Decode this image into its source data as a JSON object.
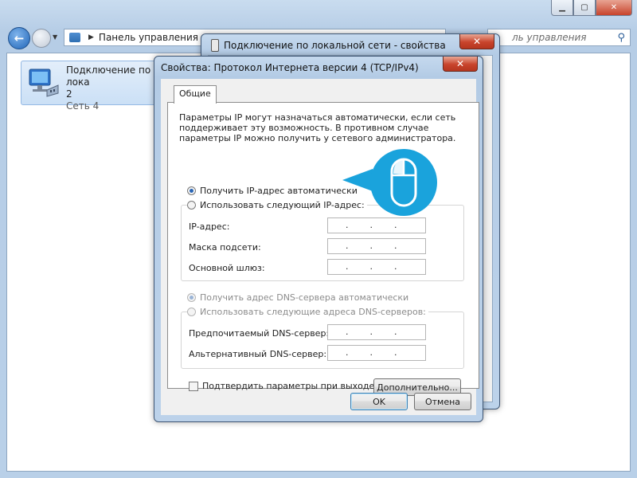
{
  "explorer": {
    "address_path": "Панель управления",
    "search_placeholder": "Поиск: Панель управления",
    "search_visible": "ль управления",
    "connection": {
      "name_line1": "Подключение по лока",
      "name_line2": "2",
      "network": "Сеть 4"
    },
    "window_buttons": {
      "minimize": "▁",
      "maximize": "▢",
      "close": "✕"
    }
  },
  "dialog_properties": {
    "title": "Подключение по локальной сети - свойства",
    "close": "✕"
  },
  "dialog_ipv4": {
    "title": "Свойства: Протокол Интернета версии 4 (TCP/IPv4)",
    "close": "✕",
    "tab": "Общие",
    "info": "Параметры IP могут назначаться автоматически, если сеть поддерживает эту возможность. В противном случае параметры IP можно получить у сетевого администратора.",
    "ip_auto": "Получить IP-адрес автоматически",
    "ip_manual": "Использовать следующий IP-адрес:",
    "ip_label": "IP-адрес:",
    "mask_label": "Маска подсети:",
    "gateway_label": "Основной шлюз:",
    "dns_auto": "Получить адрес DNS-сервера автоматически",
    "dns_manual": "Использовать следующие адреса DNS-серверов:",
    "dns_pref_label": "Предпочитаемый DNS-сервер:",
    "dns_alt_label": "Альтернативный DNS-сервер:",
    "validate_label": "Подтвердить параметры при выходе",
    "advanced": "Дополнительно...",
    "ok": "OK",
    "cancel": "Отмена",
    "dot": "."
  },
  "state": {
    "ip_mode": "auto",
    "dns_mode": "auto",
    "validate_checked": false
  },
  "colors": {
    "accent": "#1aa3dc",
    "radio_selected": "#2a66b5"
  }
}
